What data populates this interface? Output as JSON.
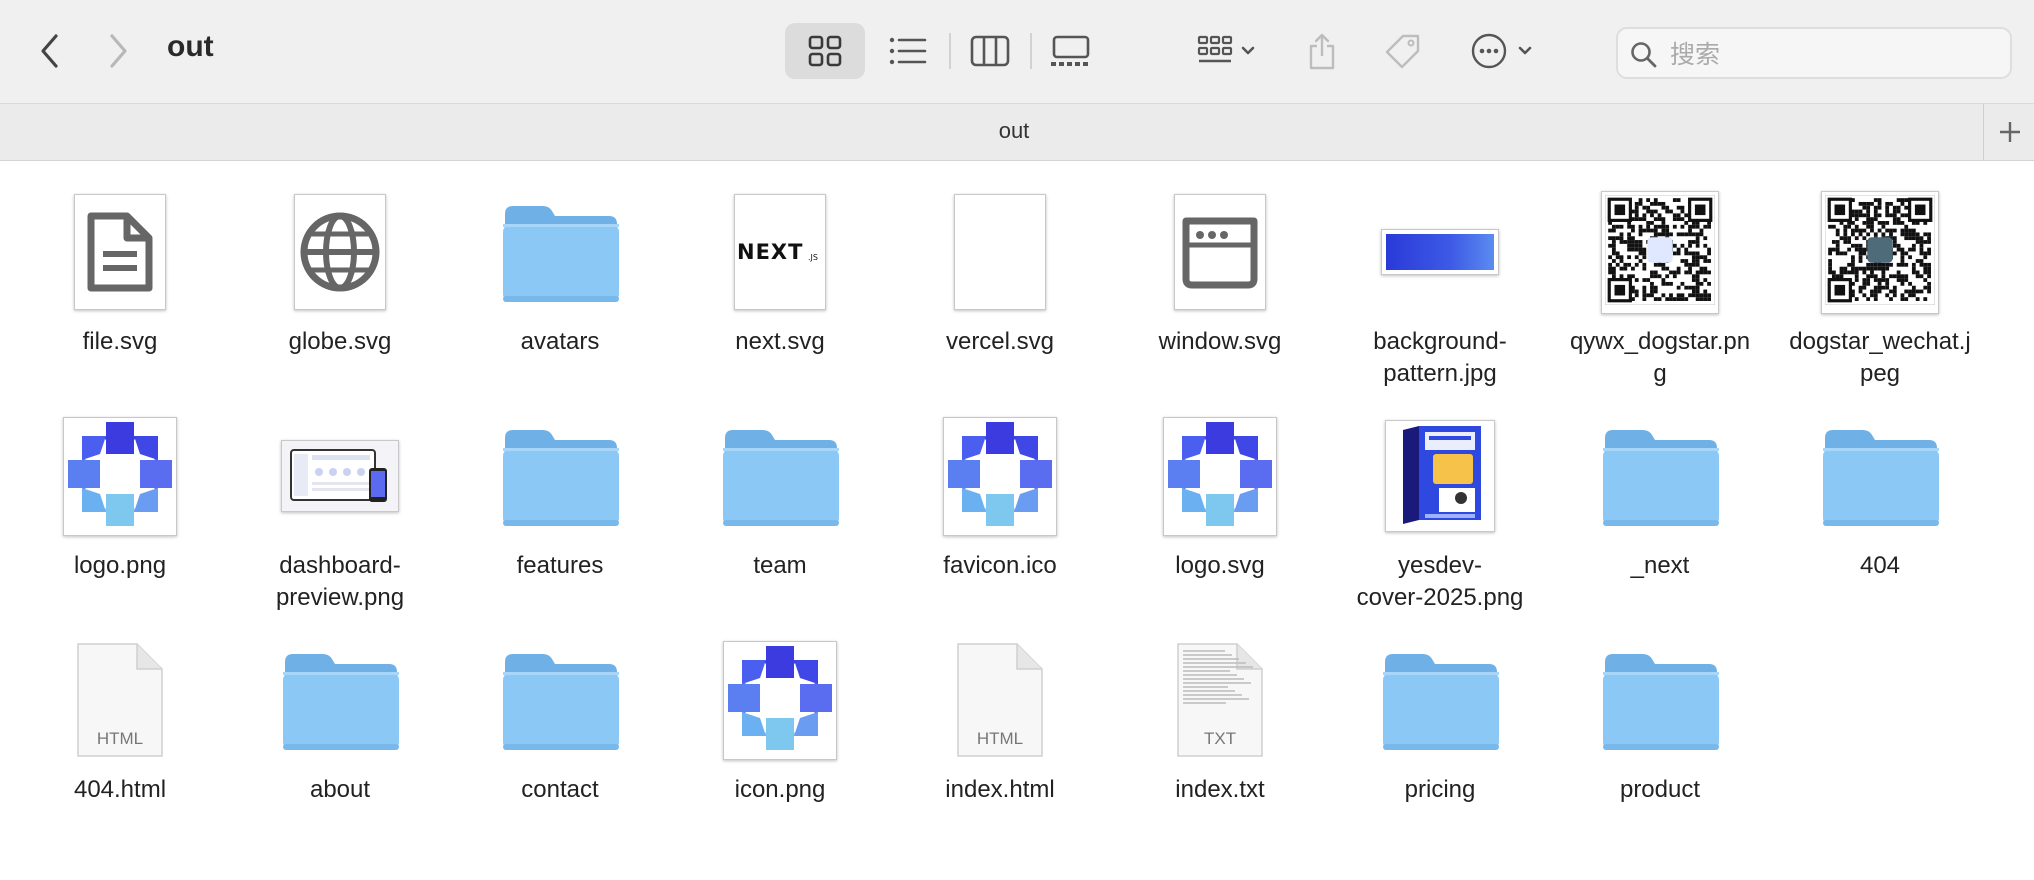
{
  "window": {
    "title": "out",
    "tab_label": "out"
  },
  "toolbar": {
    "back": "chevron-left-icon",
    "forward": "chevron-right-icon",
    "views": [
      "icon-view",
      "list-view",
      "column-view",
      "gallery-view"
    ],
    "active_view": "icon-view"
  },
  "search": {
    "placeholder": "搜索",
    "value": ""
  },
  "files": [
    {
      "name": "file.svg",
      "kind": "svg-file"
    },
    {
      "name": "globe.svg",
      "kind": "svg-globe"
    },
    {
      "name": "avatars",
      "kind": "folder"
    },
    {
      "name": "next.svg",
      "kind": "svg-next"
    },
    {
      "name": "vercel.svg",
      "kind": "svg-blank"
    },
    {
      "name": "window.svg",
      "kind": "svg-window"
    },
    {
      "name": "background-\npattern.jpg",
      "kind": "image-bg"
    },
    {
      "name": "qywx_dogstar.pn\ng",
      "kind": "image-qr"
    },
    {
      "name": "dogstar_wechat.j\npeg",
      "kind": "image-qr2"
    },
    {
      "name": "logo.png",
      "kind": "logo"
    },
    {
      "name": "dashboard-\npreview.png",
      "kind": "image-dashboard"
    },
    {
      "name": "features",
      "kind": "folder"
    },
    {
      "name": "team",
      "kind": "folder"
    },
    {
      "name": "favicon.ico",
      "kind": "logo-pixel"
    },
    {
      "name": "logo.svg",
      "kind": "logo"
    },
    {
      "name": "yesdev-\ncover-2025.png",
      "kind": "image-cover"
    },
    {
      "name": "_next",
      "kind": "folder"
    },
    {
      "name": "404",
      "kind": "folder"
    },
    {
      "name": "404.html",
      "kind": "html",
      "ext": "HTML"
    },
    {
      "name": "about",
      "kind": "folder"
    },
    {
      "name": "contact",
      "kind": "folder"
    },
    {
      "name": "icon.png",
      "kind": "logo"
    },
    {
      "name": "index.html",
      "kind": "html",
      "ext": "HTML"
    },
    {
      "name": "index.txt",
      "kind": "txt",
      "ext": "TXT"
    },
    {
      "name": "pricing",
      "kind": "folder"
    },
    {
      "name": "product",
      "kind": "folder"
    }
  ],
  "colors": {
    "folder": "#8cc8f5",
    "folder_tab": "#6fb0e6",
    "logo_dark": "#3b3be0",
    "logo_mid": "#5a6cf0",
    "logo_light": "#7ec8f0"
  }
}
